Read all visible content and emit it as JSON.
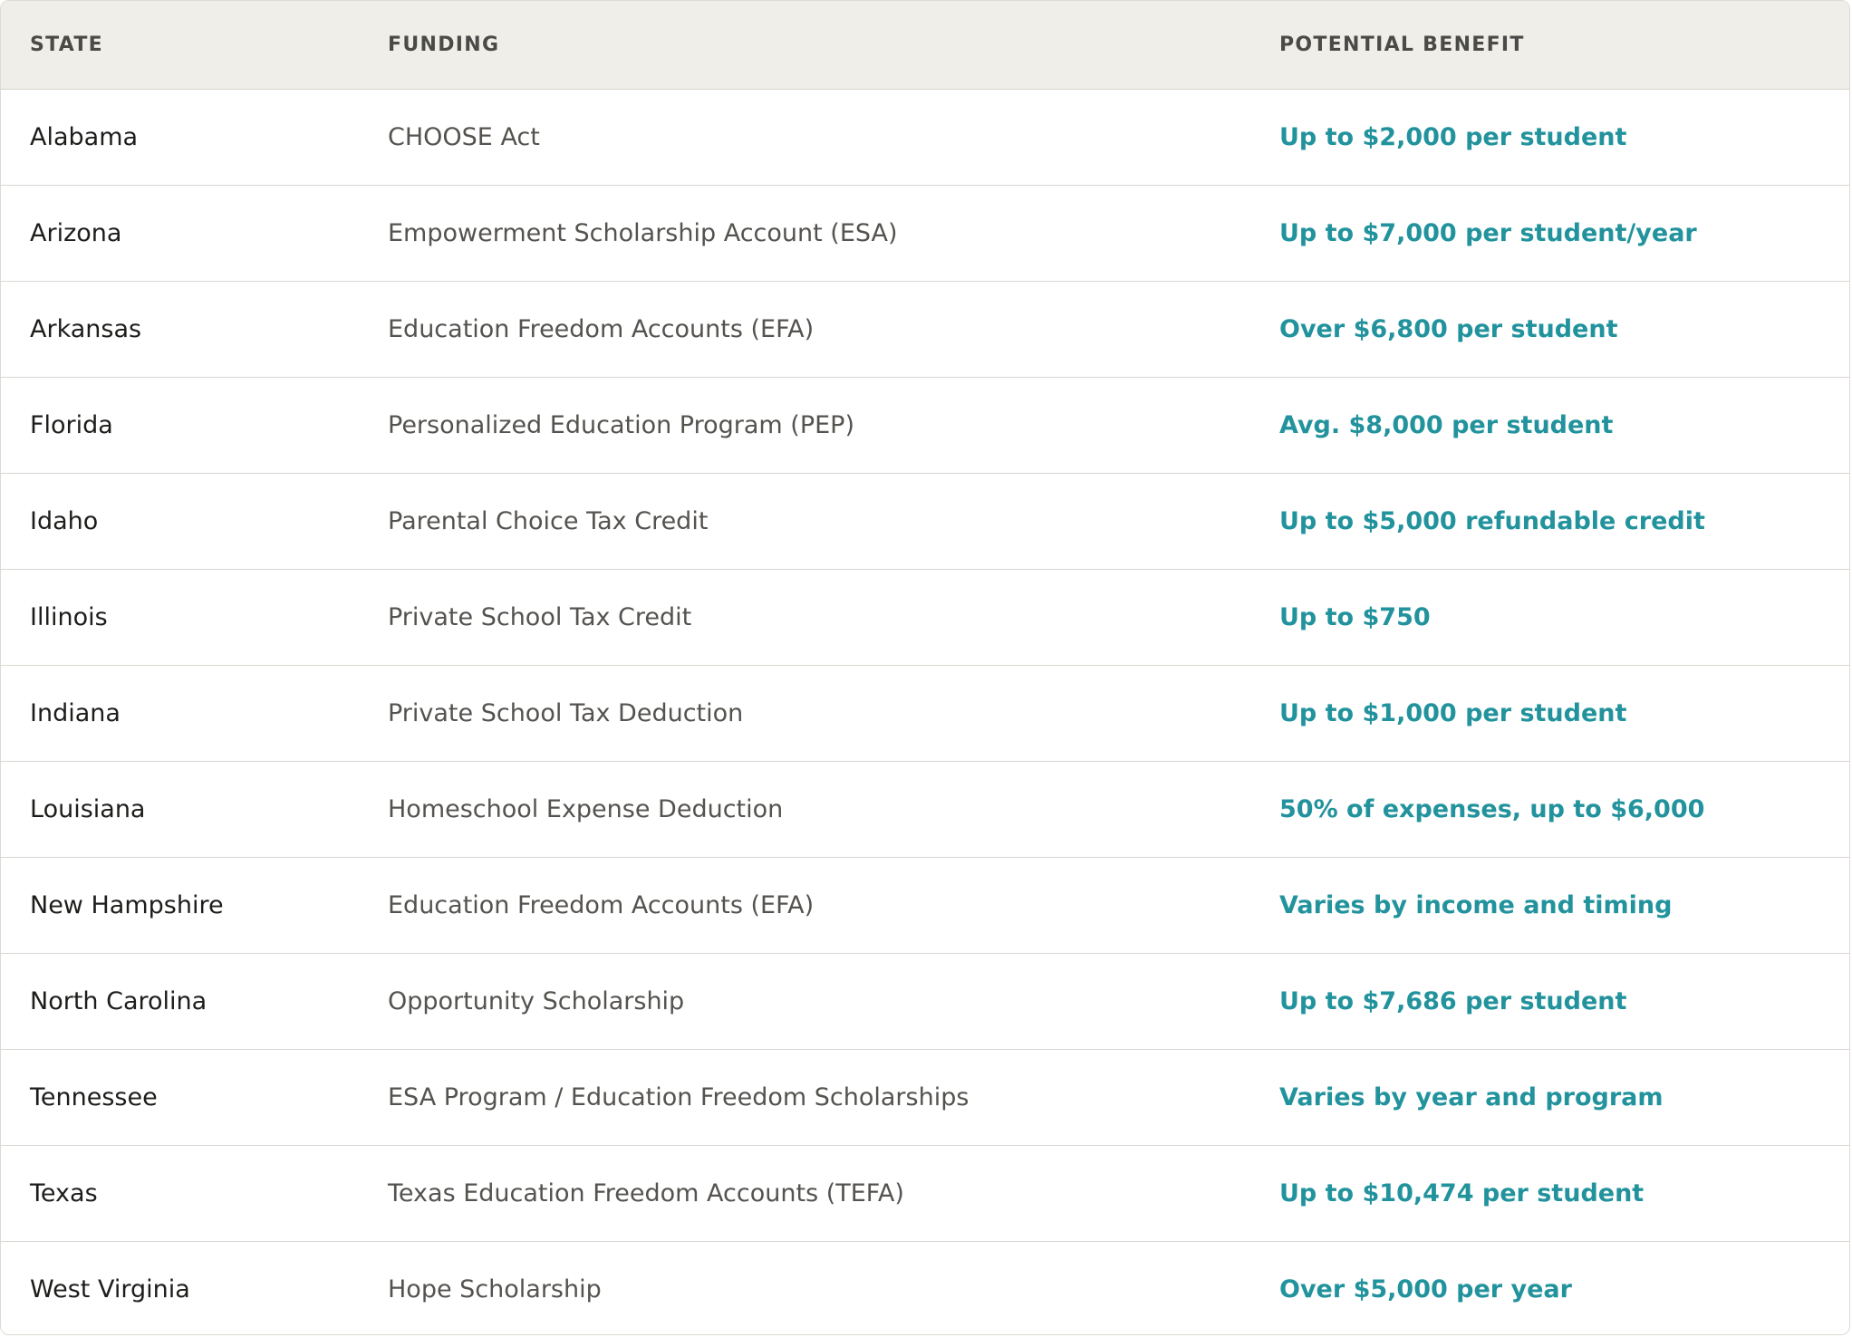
{
  "colors": {
    "header_bg": "#f0eee8",
    "accent": "#22939d",
    "state_text": "#1d1d1b",
    "funding_text": "#55534f",
    "border": "#d9d7d2"
  },
  "table": {
    "headers": {
      "state": "STATE",
      "funding": "FUNDING",
      "benefit": "POTENTIAL BENEFIT"
    },
    "rows": [
      {
        "state": "Alabama",
        "funding": "CHOOSE Act",
        "benefit": "Up to $2,000 per student"
      },
      {
        "state": "Arizona",
        "funding": "Empowerment Scholarship Account (ESA)",
        "benefit": "Up to $7,000 per student/year"
      },
      {
        "state": "Arkansas",
        "funding": "Education Freedom Accounts (EFA)",
        "benefit": "Over $6,800 per student"
      },
      {
        "state": "Florida",
        "funding": "Personalized Education Program (PEP)",
        "benefit": "Avg. $8,000 per student"
      },
      {
        "state": "Idaho",
        "funding": "Parental Choice Tax Credit",
        "benefit": "Up to $5,000 refundable credit"
      },
      {
        "state": "Illinois",
        "funding": "Private School Tax Credit",
        "benefit": "Up to $750"
      },
      {
        "state": "Indiana",
        "funding": "Private School Tax Deduction",
        "benefit": "Up to $1,000 per student"
      },
      {
        "state": "Louisiana",
        "funding": "Homeschool Expense Deduction",
        "benefit": "50% of expenses, up to $6,000"
      },
      {
        "state": "New Hampshire",
        "funding": "Education Freedom Accounts (EFA)",
        "benefit": "Varies by income and timing"
      },
      {
        "state": "North Carolina",
        "funding": "Opportunity Scholarship",
        "benefit": "Up to $7,686 per student"
      },
      {
        "state": "Tennessee",
        "funding": "ESA Program / Education Freedom Scholarships",
        "benefit": "Varies by year and program"
      },
      {
        "state": "Texas",
        "funding": "Texas Education Freedom Accounts (TEFA)",
        "benefit": "Up to $10,474 per student"
      },
      {
        "state": "West Virginia",
        "funding": "Hope Scholarship",
        "benefit": "Over $5,000 per year"
      }
    ]
  }
}
